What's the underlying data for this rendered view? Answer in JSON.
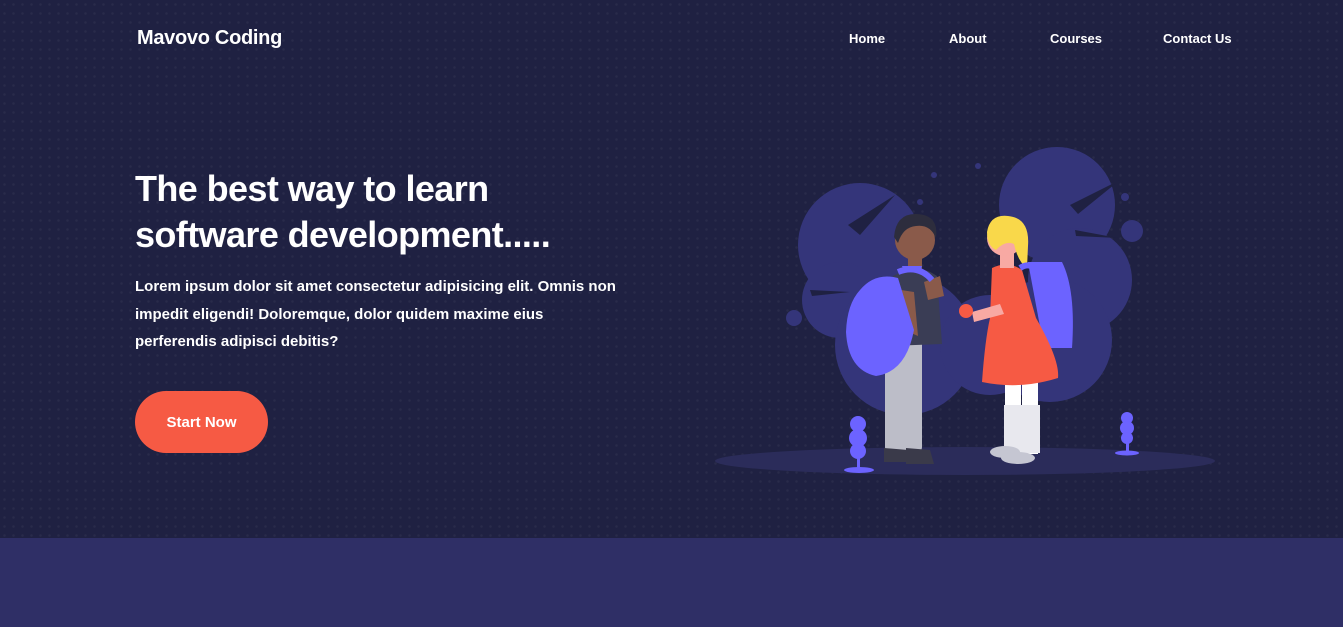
{
  "brand": {
    "name": "Mavovo Coding"
  },
  "nav": {
    "items": [
      {
        "label": "Home"
      },
      {
        "label": "About"
      },
      {
        "label": "Courses"
      },
      {
        "label": "Contact Us"
      }
    ]
  },
  "hero": {
    "title_line1": "The best way to learn",
    "title_line2": "software development.....",
    "description": "Lorem ipsum dolor sit amet consectetur adipisicing elit. Omnis non impedit eligendi! Doloremque, dolor quidem maxime eius perferendis adipisci debitis?",
    "cta_label": "Start Now"
  },
  "colors": {
    "hero_background": "#1f2142",
    "section_background": "#2f2f66",
    "accent": "#f65a44",
    "illustration_purple": "#6c63ff",
    "blob": "#34357a"
  },
  "icons": {
    "illustration": "students-with-backpacks-illustration"
  }
}
